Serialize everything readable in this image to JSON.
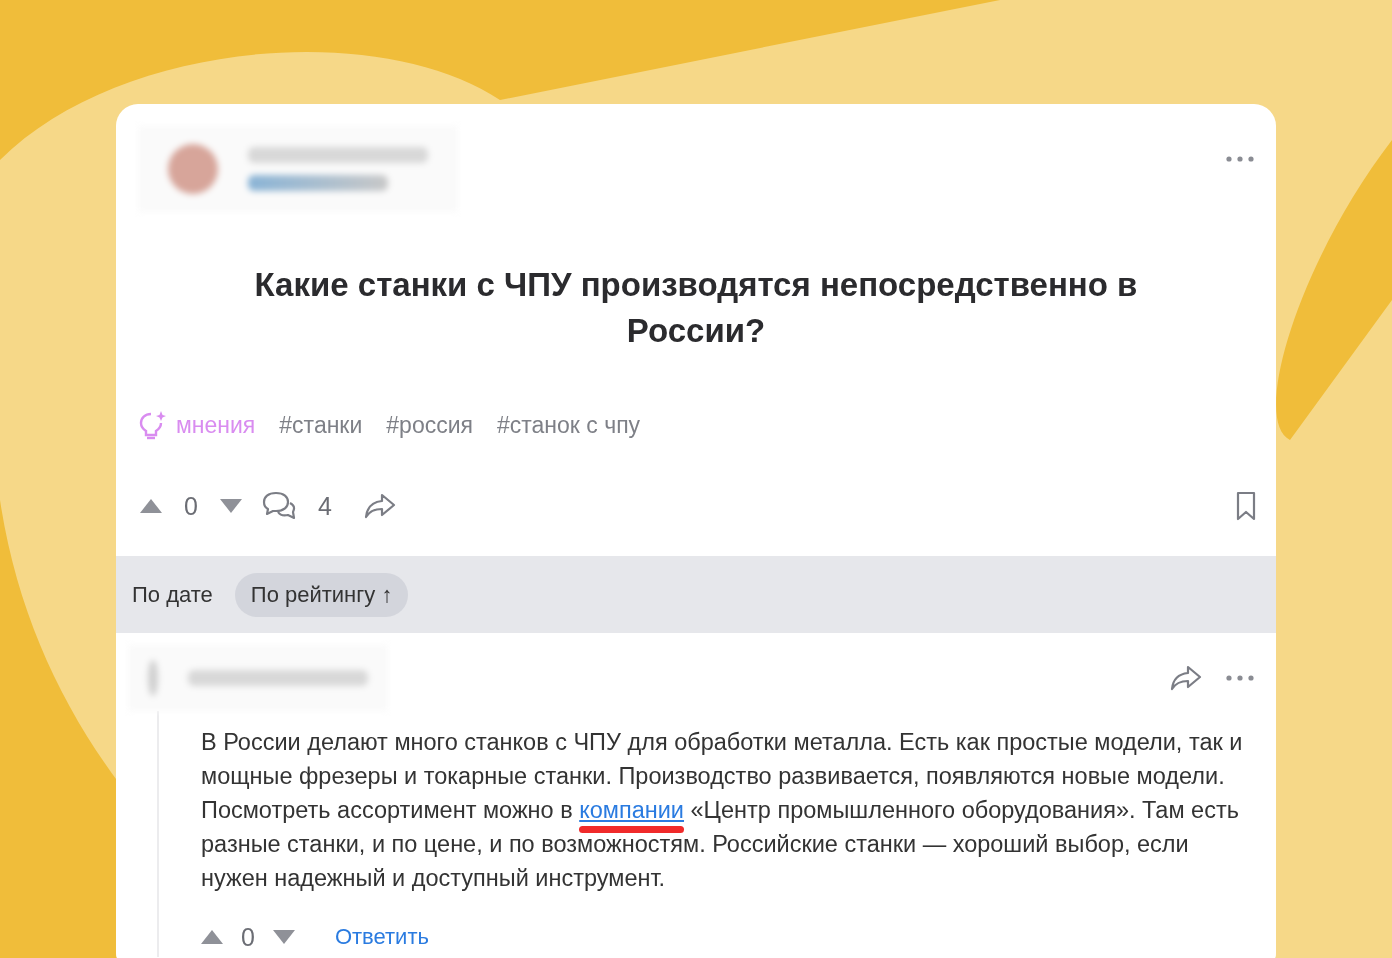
{
  "question": {
    "title": "Какие станки с ЧПУ производятся непосредственно в России?",
    "category": "мнения",
    "tags": [
      "#станки",
      "#россия",
      "#станок с чпу"
    ],
    "votes": "0",
    "comments": "4",
    "bookmarked": false
  },
  "sort": [
    {
      "label": "По дате",
      "selected": false
    },
    {
      "label": "По рейтингу",
      "selected": true,
      "arrow": "↑"
    }
  ],
  "answer": {
    "text_before": "В России делают много станков с ЧПУ для обработки металла. Есть как простые модели, так и мощные фрезеры и токарные станки. Производство развивается, появляются новые модели. Посмотреть ассортимент можно в ",
    "link": "компании",
    "link_highlighted": true,
    "text_after": " «Центр промышленного оборудования». Там есть разные станки, и по цене, и по возможностям. Российские станки — хороший выбор, если нужен надежный и доступный инструмент.",
    "votes": "0",
    "reply": "Ответить"
  }
}
